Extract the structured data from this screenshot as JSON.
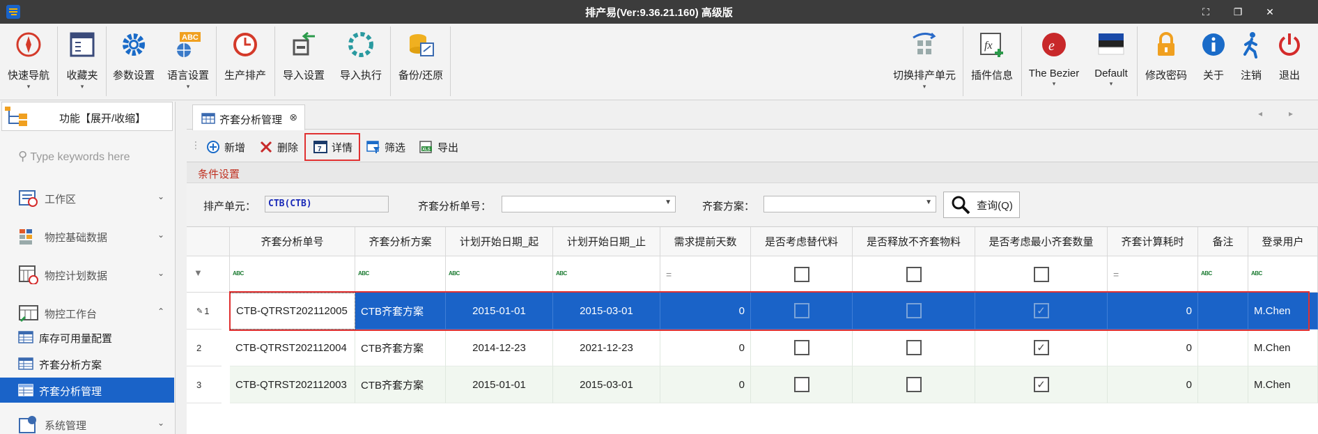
{
  "app": {
    "title": "排产易(Ver:9.36.21.160) 高级版"
  },
  "ribbon": {
    "left": [
      {
        "label": "快速导航",
        "icon": "compass-icon",
        "dropdown": true
      },
      {
        "label": "收藏夹",
        "icon": "favorites-window-icon",
        "dropdown": true
      },
      {
        "label": "参数设置",
        "icon": "gear-icon",
        "dropdown": false
      },
      {
        "label": "语言设置",
        "icon": "abc-language-icon",
        "dropdown": true
      },
      {
        "label": "生产排产",
        "icon": "clock-icon",
        "dropdown": false
      },
      {
        "label": "导入设置",
        "icon": "import-settings-icon",
        "dropdown": false
      },
      {
        "label": "导入执行",
        "icon": "import-run-icon",
        "dropdown": false
      },
      {
        "label": "备份/还原",
        "icon": "database-backup-icon",
        "dropdown": false
      }
    ],
    "right": [
      {
        "label": "切换排产单元",
        "icon": "switch-unit-icon",
        "dropdown": true
      },
      {
        "label": "插件信息",
        "icon": "plugin-fx-icon",
        "dropdown": false
      },
      {
        "label": "The Bezier",
        "icon": "bezier-theme-icon",
        "dropdown": true
      },
      {
        "label": "Default",
        "icon": "default-theme-icon",
        "dropdown": true
      },
      {
        "label": "修改密码",
        "icon": "lock-icon",
        "dropdown": false
      },
      {
        "label": "关于",
        "icon": "info-icon",
        "dropdown": false
      },
      {
        "label": "注销",
        "icon": "walk-out-icon",
        "dropdown": false
      },
      {
        "label": "退出",
        "icon": "power-icon",
        "dropdown": false
      }
    ]
  },
  "side": {
    "header": "功能【展开/收缩】",
    "search_placeholder": "Type keywords here",
    "groups": [
      {
        "label": "工作区",
        "icon": "workspace-icon",
        "chevron": "⌄"
      },
      {
        "label": "物控基础数据",
        "icon": "basic-data-icon",
        "chevron": "⌄"
      },
      {
        "label": "物控计划数据",
        "icon": "plan-data-icon",
        "chevron": "⌄"
      },
      {
        "label": "物控工作台",
        "icon": "workbench-icon",
        "chevron": "⌃"
      }
    ],
    "items": [
      {
        "label": "库存可用量配置"
      },
      {
        "label": "齐套分析方案"
      },
      {
        "label": "齐套分析管理"
      }
    ],
    "bottom_group": {
      "label": "系统管理",
      "chevron": "⌄"
    }
  },
  "tab": {
    "label": "齐套分析管理",
    "close": "⊗"
  },
  "toolbar": {
    "add": "新增",
    "delete": "删除",
    "detail": "详情",
    "filter": "筛选",
    "export": "导出"
  },
  "conditions": {
    "title": "条件设置",
    "unit_label": "排产单元：",
    "unit_value": "CTB(CTB)",
    "order_label": "齐套分析单号：",
    "order_value": "",
    "scheme_label": "齐套方案：",
    "scheme_value": "",
    "query_label": "查询(Q)"
  },
  "grid": {
    "columns": [
      "齐套分析单号",
      "齐套分析方案",
      "计划开始日期_起",
      "计划开始日期_止",
      "需求提前天数",
      "是否考虑替代料",
      "是否释放不齐套物料",
      "是否考虑最小齐套数量",
      "齐套计算耗时",
      "备注",
      "登录用户"
    ],
    "rows": [
      {
        "num": "1",
        "order": "CTB-QTRST202112005",
        "scheme": "CTB齐套方案",
        "start": "2015-01-01",
        "end": "2015-03-01",
        "days": "0",
        "sub": false,
        "release": false,
        "minqty": true,
        "cost": "0",
        "remark": "",
        "user": "M.Chen"
      },
      {
        "num": "2",
        "order": "CTB-QTRST202112004",
        "scheme": "CTB齐套方案",
        "start": "2014-12-23",
        "end": "2021-12-23",
        "days": "0",
        "sub": false,
        "release": false,
        "minqty": true,
        "cost": "0",
        "remark": "",
        "user": "M.Chen"
      },
      {
        "num": "3",
        "order": "CTB-QTRST202112003",
        "scheme": "CTB齐套方案",
        "start": "2015-01-01",
        "end": "2015-03-01",
        "days": "0",
        "sub": false,
        "release": false,
        "minqty": true,
        "cost": "0",
        "remark": "",
        "user": "M.Chen"
      }
    ]
  },
  "colors": {
    "accent": "#1a63c8",
    "highlight": "#e03030",
    "titlebar": "#3c3c3c"
  }
}
